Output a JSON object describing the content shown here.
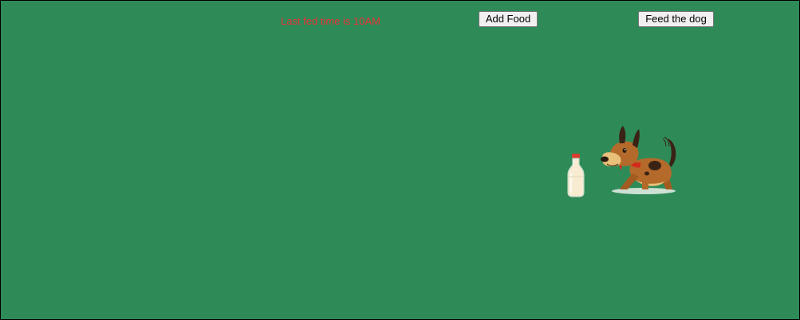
{
  "status": {
    "last_fed_text": "Last fed time is 10AM"
  },
  "buttons": {
    "add_food_label": "Add Food",
    "feed_dog_label": "Feed the dog"
  },
  "sprites": {
    "milk_icon": "milk-bottle-icon",
    "dog_icon": "dog-icon"
  },
  "colors": {
    "background": "#2e8b57",
    "status_text": "#e8333a",
    "dog_body": "#b36a2b",
    "collar": "#d42a1b"
  }
}
